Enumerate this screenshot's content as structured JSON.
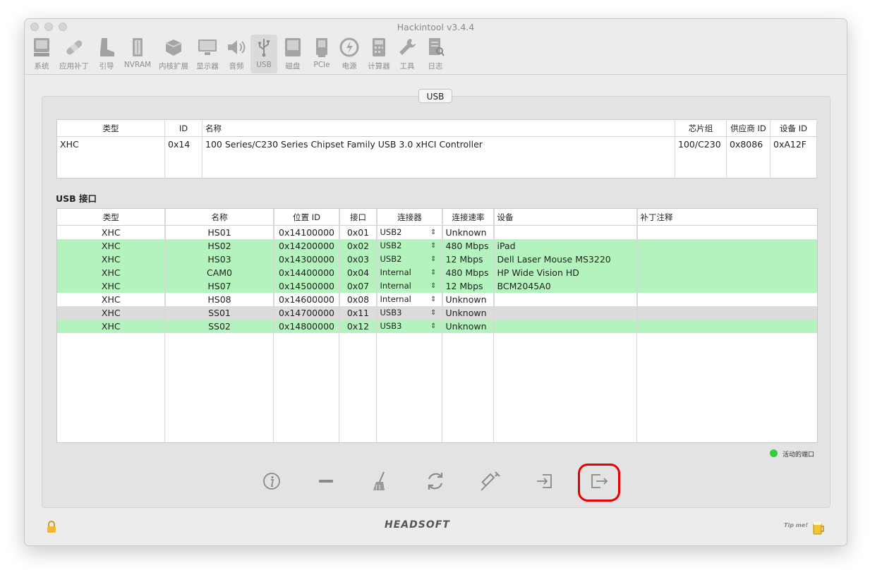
{
  "window": {
    "title": "Hackintool v3.4.4"
  },
  "toolbar": {
    "items": [
      {
        "label": "系统",
        "icon": "system-icon"
      },
      {
        "label": "应用补丁",
        "icon": "bandage-icon"
      },
      {
        "label": "引导",
        "icon": "boot-icon"
      },
      {
        "label": "NVRAM",
        "icon": "nvram-icon"
      },
      {
        "label": "内核扩展",
        "icon": "kext-icon"
      },
      {
        "label": "显示器",
        "icon": "display-icon"
      },
      {
        "label": "音频",
        "icon": "speaker-icon"
      },
      {
        "label": "USB",
        "icon": "usb-icon",
        "active": true
      },
      {
        "label": "磁盘",
        "icon": "disk-icon"
      },
      {
        "label": "PCIe",
        "icon": "pcie-icon"
      },
      {
        "label": "电源",
        "icon": "power-icon"
      },
      {
        "label": "计算器",
        "icon": "calculator-icon"
      },
      {
        "label": "工具",
        "icon": "tools-icon"
      },
      {
        "label": "日志",
        "icon": "log-icon"
      }
    ]
  },
  "section": {
    "title": "USB"
  },
  "controllers": {
    "headers": [
      "类型",
      "ID",
      "名称",
      "芯片组",
      "供应商 ID",
      "设备 ID"
    ],
    "rows": [
      [
        "XHC",
        "0x14",
        "100 Series/C230 Series Chipset Family USB 3.0 xHCI Controller",
        "100/C230",
        "0x8086",
        "0xA12F"
      ]
    ]
  },
  "ports": {
    "label": "USB 接口",
    "headers": [
      "类型",
      "名称",
      "位置 ID",
      "接口",
      "连接器",
      "连接速率",
      "设备",
      "补丁注释"
    ],
    "rows": [
      {
        "type": "XHC",
        "name": "HS01",
        "location": "0x14100000",
        "port": "0x01",
        "connector": "USB2",
        "speed": "Unknown",
        "device": "",
        "comment": "",
        "state": "none"
      },
      {
        "type": "XHC",
        "name": "HS02",
        "location": "0x14200000",
        "port": "0x02",
        "connector": "USB2",
        "speed": "480 Mbps",
        "device": "iPad",
        "comment": "",
        "state": "active"
      },
      {
        "type": "XHC",
        "name": "HS03",
        "location": "0x14300000",
        "port": "0x03",
        "connector": "USB2",
        "speed": "12 Mbps",
        "device": "Dell Laser Mouse MS3220",
        "comment": "",
        "state": "active"
      },
      {
        "type": "XHC",
        "name": "CAM0",
        "location": "0x14400000",
        "port": "0x04",
        "connector": "Internal",
        "speed": "480 Mbps",
        "device": "HP Wide Vision HD",
        "comment": "",
        "state": "active"
      },
      {
        "type": "XHC",
        "name": "HS07",
        "location": "0x14500000",
        "port": "0x07",
        "connector": "Internal",
        "speed": "12 Mbps",
        "device": "BCM2045A0",
        "comment": "",
        "state": "active"
      },
      {
        "type": "XHC",
        "name": "HS08",
        "location": "0x14600000",
        "port": "0x08",
        "connector": "Internal",
        "speed": "Unknown",
        "device": "",
        "comment": "",
        "state": "none"
      },
      {
        "type": "XHC",
        "name": "SS01",
        "location": "0x14700000",
        "port": "0x11",
        "connector": "USB3",
        "speed": "Unknown",
        "device": "",
        "comment": "",
        "state": "selected"
      },
      {
        "type": "XHC",
        "name": "SS02",
        "location": "0x14800000",
        "port": "0x12",
        "connector": "USB3",
        "speed": "Unknown",
        "device": "",
        "comment": "",
        "state": "active"
      }
    ]
  },
  "legend": {
    "label": "活动的端口",
    "color": "#2fd13b"
  },
  "bottom_buttons": [
    "info-icon",
    "minus-icon",
    "broom-icon",
    "refresh-icon",
    "syringe-icon",
    "import-icon",
    "export-icon"
  ],
  "footer": {
    "logo_text": "HEADSOFT",
    "tip_text": "Tip me!"
  },
  "colors": {
    "active_row": "#b4f3be",
    "selected_row": "#dcdcdc",
    "highlight": "#e60000"
  }
}
